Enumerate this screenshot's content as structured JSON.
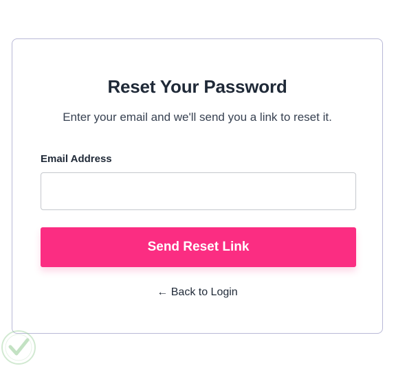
{
  "reset_form": {
    "title": "Reset Your Password",
    "subtitle": "Enter your email and we'll send you a link to reset it.",
    "email_label": "Email Address",
    "email_value": "",
    "submit_label": "Send Reset Link",
    "back_link_label": "← Back to Login"
  },
  "colors": {
    "accent": "#fb2d82",
    "card_border": "#b8b8d6",
    "text_dark": "#1f2937"
  },
  "icons": {
    "watermark": "checkmark-logo-icon"
  }
}
